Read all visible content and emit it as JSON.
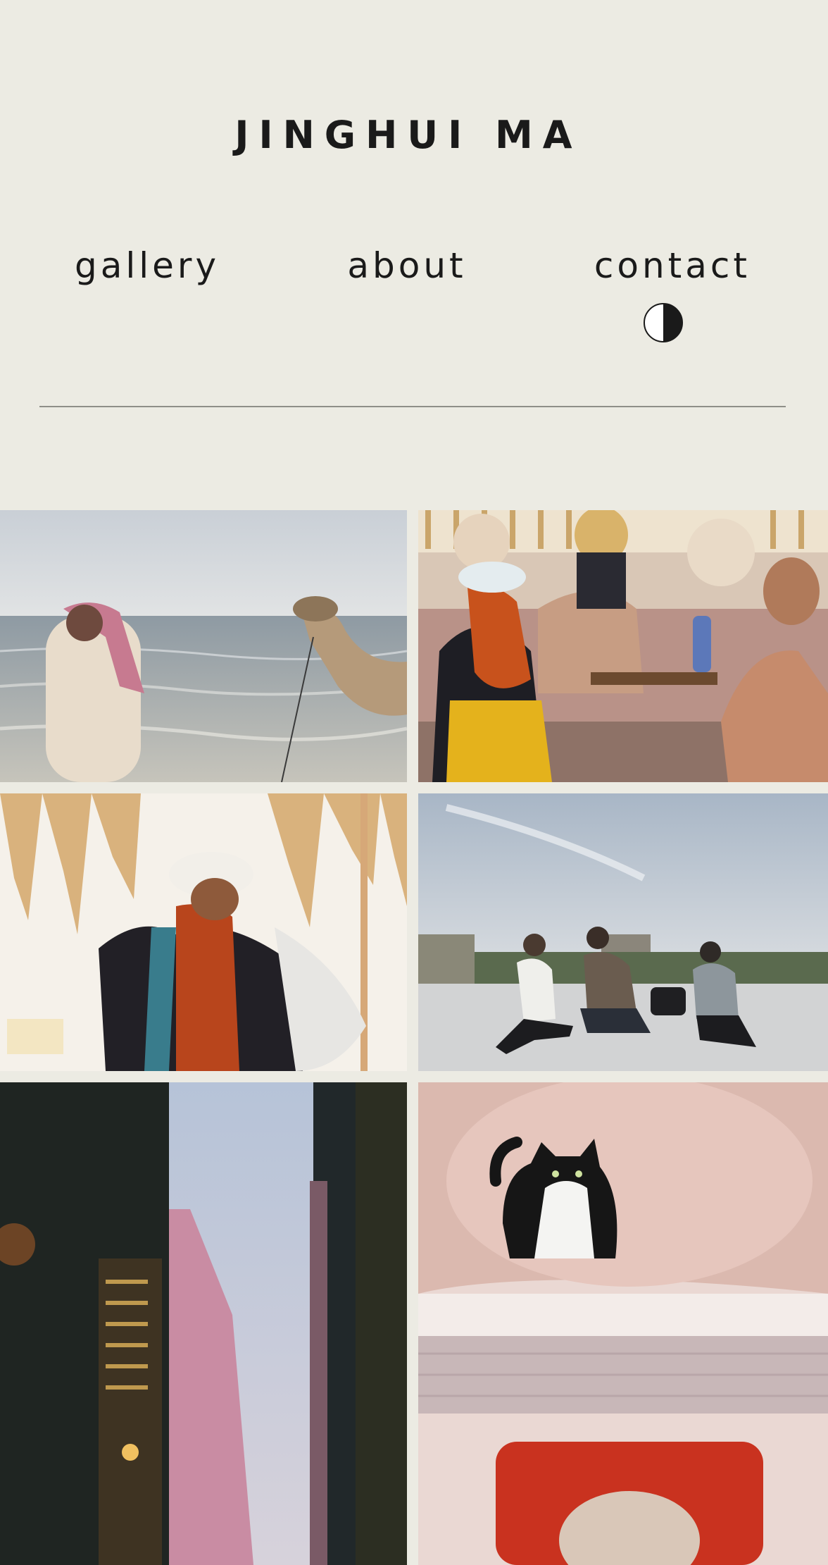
{
  "header": {
    "site_title": "JINGHUI MA",
    "nav": [
      {
        "label": "gallery"
      },
      {
        "label": "about"
      },
      {
        "label": "contact"
      }
    ],
    "theme_toggle_icon": "half-circle-icon"
  },
  "gallery": {
    "photos": [
      {
        "name": "photo-beach-camel",
        "description": ""
      },
      {
        "name": "photo-women-crafting",
        "description": ""
      },
      {
        "name": "photo-woman-scarf",
        "description": ""
      },
      {
        "name": "photo-rooftop-group",
        "description": ""
      },
      {
        "name": "photo-city-street",
        "description": ""
      },
      {
        "name": "photo-cat-bathtub",
        "description": ""
      }
    ]
  },
  "colors": {
    "background": "#ecebe3",
    "text": "#1a1a1a",
    "divider": "#8f8f88"
  }
}
